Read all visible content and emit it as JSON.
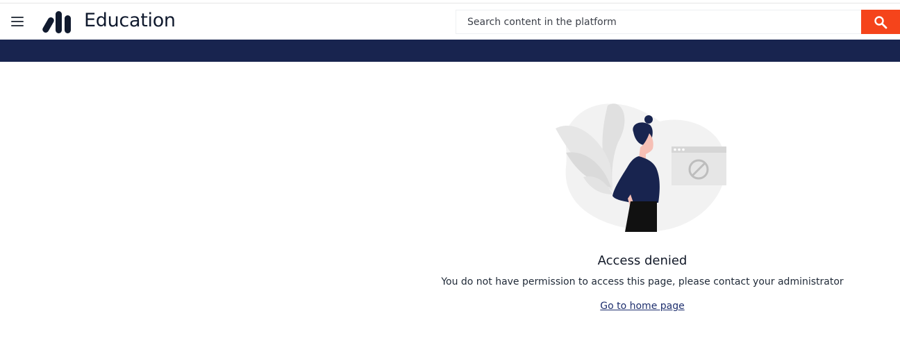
{
  "header": {
    "brand": "Education",
    "search": {
      "placeholder": "Search content in the platform",
      "value": ""
    },
    "icons": {
      "menu": "hamburger-menu-icon",
      "search": "search-icon",
      "logo": "brand-logo"
    }
  },
  "colors": {
    "accent": "#f5441b",
    "nav_band": "#18244f",
    "link": "#1e2f6e",
    "figure_navy": "#18244f",
    "figure_skin": "#f6bfb5"
  },
  "main": {
    "illustration": "access-denied-illustration",
    "title": "Access denied",
    "message": "You do not have permission to access this page, please contact your administrator",
    "home_link": "Go to home page"
  }
}
